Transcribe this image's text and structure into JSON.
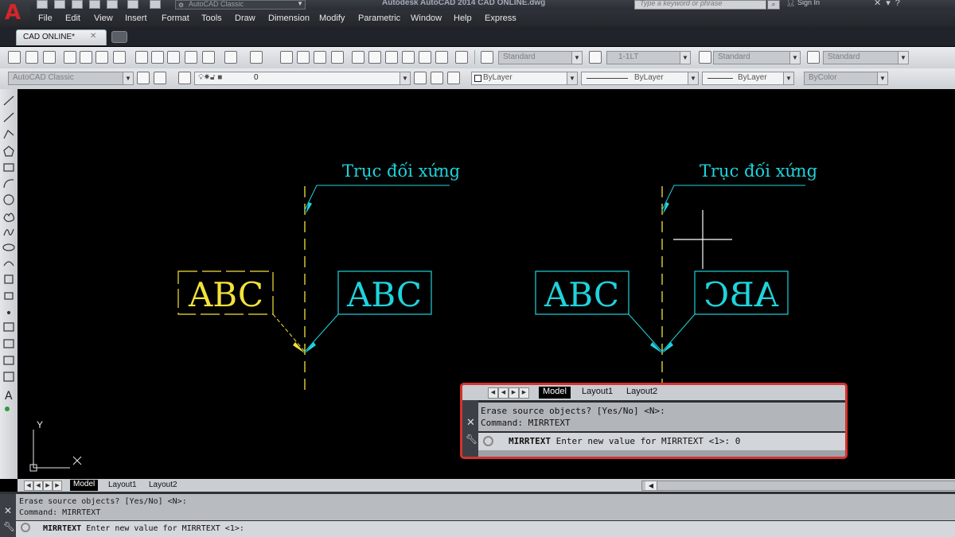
{
  "window": {
    "title": "Autodesk AutoCAD 2014    CAD ONLINE.dwg",
    "workspace_select": "AutoCAD Classic",
    "search_placeholder": "Type a keyword or phrase",
    "signin": "Sign In"
  },
  "menu": [
    "File",
    "Edit",
    "View",
    "Insert",
    "Format",
    "Tools",
    "Draw",
    "Dimension",
    "Modify",
    "Parametric",
    "Window",
    "Help",
    "Express"
  ],
  "doc_tab": {
    "label": "CAD ONLINE*",
    "close": "✕"
  },
  "toolbar1": {
    "text_style": "Standard",
    "dim_style": "1-1LT",
    "table_style": "Standard",
    "mleader_style": "Standard"
  },
  "toolbar2": {
    "workspace": "AutoCAD Classic",
    "layer": "0",
    "color": "ByLayer",
    "linetype": "ByLayer",
    "lineweight": "ByLayer",
    "plotstyle": "ByColor"
  },
  "drawing": {
    "axis_label_left": "Trục đối xứng",
    "axis_label_right": "Trục đối xứng",
    "text_source": "ABC",
    "text_mirror_correct": "ABC",
    "text_mirror_right_normal": "ABC",
    "text_mirror_reversed": "ABC",
    "ucs_y": "Y",
    "ucs_x": "X",
    "colors": {
      "yellow": "#f3e23a",
      "cyan": "#1fd3dc",
      "background": "#000000",
      "crosshair": "#ffffff"
    }
  },
  "layout_tabs": [
    "Model",
    "Layout1",
    "Layout2"
  ],
  "command": {
    "history_line1": "Erase source objects? [Yes/No] <N>:",
    "history_line2": "Command: MIRRTEXT",
    "prompt_cmd": "MIRRTEXT",
    "prompt_text": "Enter new value for MIRRTEXT <1>:",
    "callout_prompt_text": "Enter new value for MIRRTEXT <1>:",
    "callout_input": "0"
  }
}
